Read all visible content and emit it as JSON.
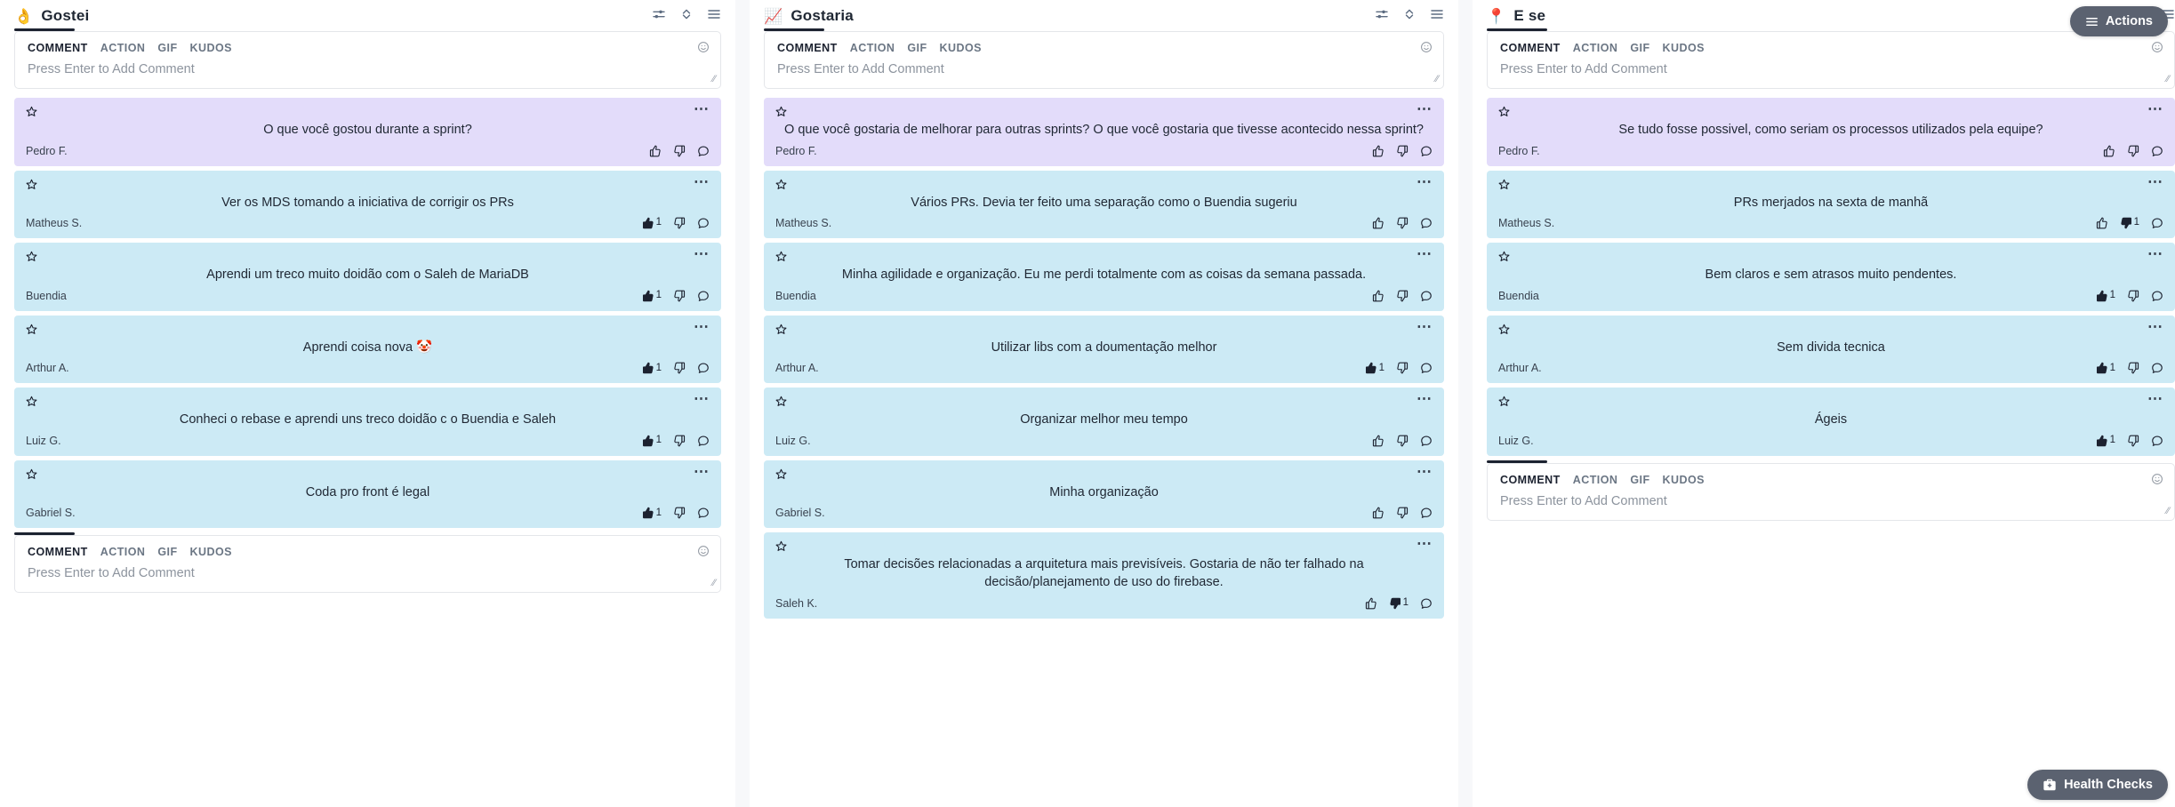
{
  "composer": {
    "tabs": [
      "COMMENT",
      "ACTION",
      "GIF",
      "KUDOS"
    ],
    "placeholder": "Press Enter to Add Comment",
    "emoji_icon": "smiley-face-icon",
    "resize_grip": "⁄⁄"
  },
  "header_icons": {
    "filter": "sliders-filter-icon",
    "sort": "sort-up-down-icon",
    "menu": "hamburger-menu-icon"
  },
  "floating": {
    "actions": {
      "label": "Actions",
      "icon": "hamburger-menu-icon",
      "color": "#5b6270"
    },
    "health_checks": {
      "label": "Health Checks",
      "icon": "medical-kit-icon",
      "color": "#5b6270"
    }
  },
  "colors": {
    "prompt_card": "#e3dcfa",
    "item_card": "#cceaf5",
    "page_background": "#f7f8fa",
    "column_background": "#ffffff",
    "accent": "#1c2230"
  },
  "columns": [
    {
      "id": "gostei",
      "emoji": "👌",
      "emoji_name": "ok-hand-emoji",
      "title": "Gostei",
      "composer_position": "both",
      "cards": [
        {
          "type": "prompt",
          "text": "O que você gostou durante a sprint?",
          "author": "Pedro F.",
          "up": 0,
          "down": 0,
          "up_active": false,
          "down_active": false
        },
        {
          "type": "item",
          "text": "Ver os MDS tomando a iniciativa de corrigir os PRs",
          "author": "Matheus S.",
          "up": 1,
          "down": 0,
          "up_active": true,
          "down_active": false
        },
        {
          "type": "item",
          "text": "Aprendi um treco muito doidão com o Saleh de MariaDB",
          "author": "Buendia",
          "up": 1,
          "down": 0,
          "up_active": true,
          "down_active": false
        },
        {
          "type": "item",
          "text": "Aprendi coisa nova 🤡",
          "author": "Arthur A.",
          "up": 1,
          "down": 0,
          "up_active": true,
          "down_active": false
        },
        {
          "type": "item",
          "text": "Conheci o rebase e aprendi uns treco doidão c o Buendia e Saleh",
          "author": "Luiz G.",
          "up": 1,
          "down": 0,
          "up_active": true,
          "down_active": false
        },
        {
          "type": "item",
          "text": "Coda pro front é legal",
          "author": "Gabriel S.",
          "up": 1,
          "down": 0,
          "up_active": true,
          "down_active": false
        }
      ]
    },
    {
      "id": "gostaria",
      "emoji": "📈",
      "emoji_name": "chart-increasing-emoji",
      "title": "Gostaria",
      "composer_position": "top",
      "cards": [
        {
          "type": "prompt",
          "text": "O que você gostaria de melhorar para outras sprints? O que você gostaria que tivesse acontecido nessa sprint?",
          "author": "Pedro F.",
          "up": 0,
          "down": 0,
          "up_active": false,
          "down_active": false
        },
        {
          "type": "item",
          "text": "Vários PRs. Devia ter feito uma separação como o Buendia sugeriu",
          "author": "Matheus S.",
          "up": 0,
          "down": 0,
          "up_active": false,
          "down_active": false
        },
        {
          "type": "item",
          "text": "Minha agilidade e organização. Eu me perdi totalmente com as coisas da semana passada.",
          "author": "Buendia",
          "up": 0,
          "down": 0,
          "up_active": false,
          "down_active": false
        },
        {
          "type": "item",
          "text": "Utilizar libs com a doumentação melhor",
          "author": "Arthur A.",
          "up": 1,
          "down": 0,
          "up_active": true,
          "down_active": false
        },
        {
          "type": "item",
          "text": "Organizar melhor meu tempo",
          "author": "Luiz G.",
          "up": 0,
          "down": 0,
          "up_active": false,
          "down_active": false
        },
        {
          "type": "item",
          "text": "Minha organização",
          "author": "Gabriel S.",
          "up": 0,
          "down": 0,
          "up_active": false,
          "down_active": false
        },
        {
          "type": "item",
          "text": "Tomar decisões relacionadas a arquitetura mais previsíveis. Gostaria de não ter falhado na decisão/planejamento de uso do firebase.",
          "author": "Saleh K.",
          "up": 0,
          "down": 1,
          "up_active": false,
          "down_active": true
        }
      ]
    },
    {
      "id": "e-se",
      "emoji": "📍",
      "emoji_name": "round-pushpin-emoji",
      "title": "E se",
      "composer_position": "both",
      "cards": [
        {
          "type": "prompt",
          "text": "Se tudo fosse possivel, como seriam os processos utilizados pela equipe?",
          "author": "Pedro F.",
          "up": 0,
          "down": 0,
          "up_active": false,
          "down_active": false
        },
        {
          "type": "item",
          "text": "PRs merjados na sexta de manhã",
          "author": "Matheus S.",
          "up": 0,
          "down": 1,
          "up_active": false,
          "down_active": true
        },
        {
          "type": "item",
          "text": "Bem claros e sem atrasos muito pendentes.",
          "author": "Buendia",
          "up": 1,
          "down": 0,
          "up_active": true,
          "down_active": false
        },
        {
          "type": "item",
          "text": "Sem divida tecnica",
          "author": "Arthur A.",
          "up": 1,
          "down": 0,
          "up_active": true,
          "down_active": false
        },
        {
          "type": "item",
          "text": "Ágeis",
          "author": "Luiz G.",
          "up": 1,
          "down": 0,
          "up_active": true,
          "down_active": false
        }
      ]
    }
  ]
}
